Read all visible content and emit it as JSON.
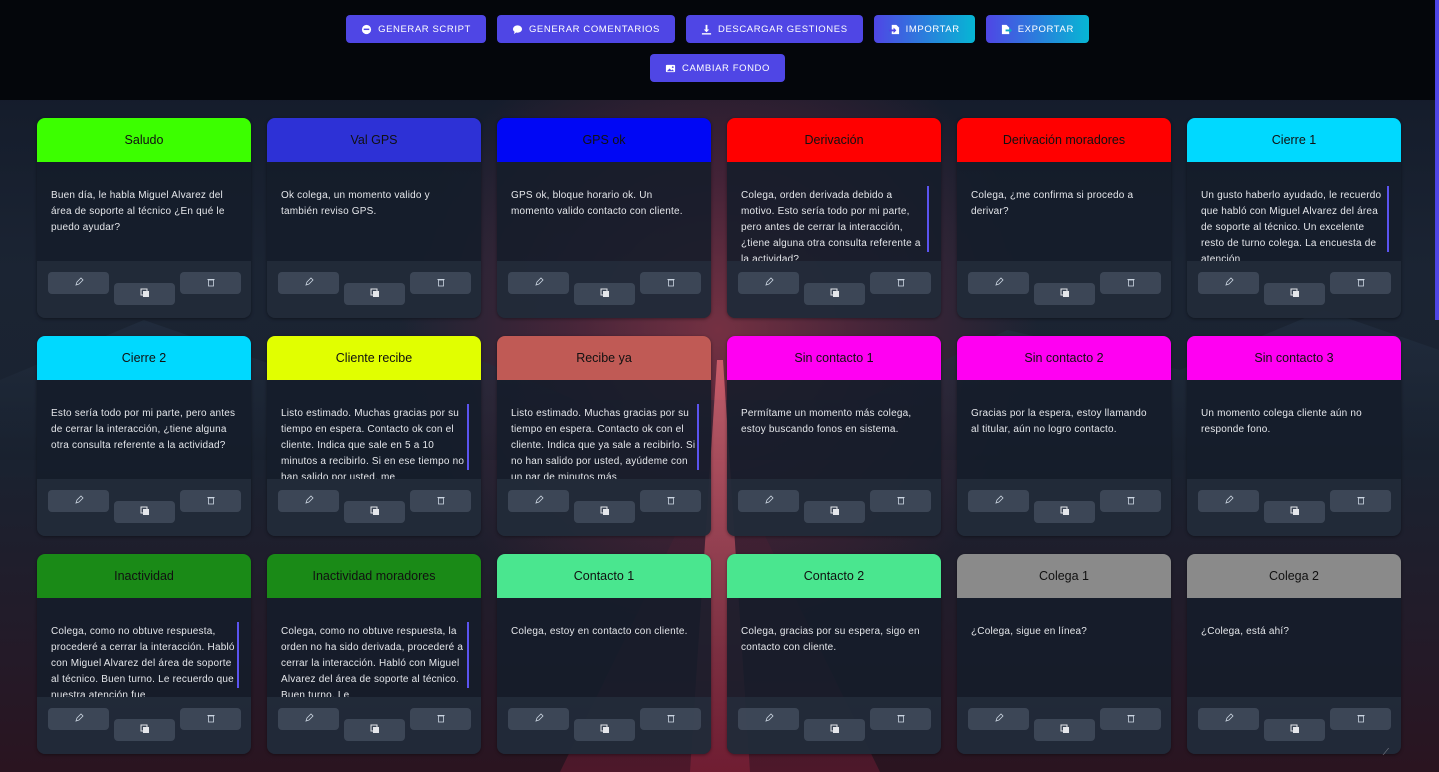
{
  "toolbar": {
    "buttons": [
      {
        "label": "Generar script",
        "icon": "robot-icon"
      },
      {
        "label": "Generar comentarios",
        "icon": "comment-icon"
      },
      {
        "label": "Descargar gestiones",
        "icon": "download-icon"
      },
      {
        "label": "Importar",
        "icon": "file-import-icon"
      },
      {
        "label": "Exportar",
        "icon": "file-export-icon"
      }
    ],
    "background_button": {
      "label": "Cambiar fondo",
      "icon": "image-icon"
    }
  },
  "colors": {
    "accent": "#4f46e5",
    "teal": "#06b6d4"
  },
  "cards": [
    {
      "title": "Saludo",
      "color": "#3cff00",
      "text": "Buen día, le habla Miguel Alvarez del área de soporte al técnico ¿En qué le puedo ayudar?",
      "scroll": false
    },
    {
      "title": "Val GPS",
      "color": "#2d31d6",
      "text": "Ok colega, un momento valido y también reviso GPS.",
      "scroll": false
    },
    {
      "title": "GPS ok",
      "color": "#0007f5",
      "text": "GPS ok, bloque horario ok. Un momento valido contacto con cliente.",
      "scroll": false
    },
    {
      "title": "Derivación",
      "color": "#ff0000",
      "text": "Colega, orden derivada debido a motivo. Esto sería todo por mi parte, pero antes de cerrar la interacción, ¿tiene alguna otra consulta referente a la actividad?",
      "scroll": true
    },
    {
      "title": "Derivación moradores",
      "color": "#ff0000",
      "text": "Colega, ¿me confirma si procedo a derivar?",
      "scroll": false
    },
    {
      "title": "Cierre 1",
      "color": "#00d9ff",
      "text": "Un gusto haberlo ayudado, le recuerdo que habló con Miguel Alvarez del área de soporte al técnico. Un excelente resto de turno colega. La encuesta de atención",
      "scroll": true
    },
    {
      "title": "Cierre 2",
      "color": "#00d9ff",
      "text": "Esto sería todo por mi parte, pero antes de cerrar la interacción, ¿tiene alguna otra consulta referente a la actividad?",
      "scroll": false
    },
    {
      "title": "Cliente recibe",
      "color": "#e1ff00",
      "text": "Listo estimado. Muchas gracias por su tiempo en espera. Contacto ok con el cliente. Indica que sale en 5 a 10 minutos a recibirlo. Si en ese tiempo no han salido por usted, me",
      "scroll": true
    },
    {
      "title": "Recibe ya",
      "color": "#c05a55",
      "text": "Listo estimado. Muchas gracias por su tiempo en espera. Contacto ok con el cliente. Indica que ya sale a recibirlo. Si no han salido por usted, ayúdeme con un par de minutos más",
      "scroll": true
    },
    {
      "title": "Sin contacto 1",
      "color": "#ff00f2",
      "text": "Permítame un momento más colega, estoy buscando fonos en sistema.",
      "scroll": false
    },
    {
      "title": "Sin contacto 2",
      "color": "#ff00f2",
      "text": "Gracias por la espera, estoy llamando al titular, aún no logro contacto.",
      "scroll": false
    },
    {
      "title": "Sin contacto 3",
      "color": "#ff00f2",
      "text": "Un momento colega cliente aún no responde fono.",
      "scroll": false
    },
    {
      "title": "Inactividad",
      "color": "#1a8a17",
      "text": "Colega, como no obtuve respuesta, procederé a cerrar la interacción. Habló con Miguel Alvarez del área de soporte al técnico. Buen turno. Le recuerdo que nuestra atención fue",
      "scroll": true
    },
    {
      "title": "Inactividad moradores",
      "color": "#1a8a17",
      "text": "Colega, como no obtuve respuesta, la orden no ha sido derivada, procederé a cerrar la interacción. Habló con Miguel Alvarez del área de soporte al técnico. Buen turno. Le",
      "scroll": true
    },
    {
      "title": "Contacto 1",
      "color": "#4ae68f",
      "text": "Colega, estoy en contacto con cliente.",
      "scroll": false
    },
    {
      "title": "Contacto 2",
      "color": "#4ae68f",
      "text": "Colega, gracias por su espera, sigo en contacto con cliente.",
      "scroll": false
    },
    {
      "title": "Colega 1",
      "color": "#8a8a8a",
      "text": "¿Colega, sigue en línea?",
      "scroll": false
    },
    {
      "title": "Colega 2",
      "color": "#8a8a8a",
      "text": "¿Colega, está ahí?",
      "scroll": false
    }
  ]
}
